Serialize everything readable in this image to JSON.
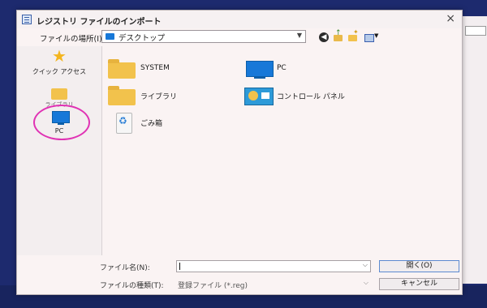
{
  "dialog": {
    "title": "レジストリ ファイルのインポート",
    "close_glyph": "×"
  },
  "location": {
    "label": "ファイルの場所(I):",
    "value": "デスクトップ"
  },
  "toolbar": {
    "back_glyph": "◀",
    "up_glyph": "↑",
    "new_folder_glyph": "✦",
    "view_menu_glyph": "▼"
  },
  "sidebar": {
    "items": [
      {
        "label": "クイック アクセス",
        "icon": "star-icon"
      },
      {
        "label": "ライブラリ",
        "icon": "folder-icon"
      },
      {
        "label": "PC",
        "icon": "monitor-icon"
      }
    ]
  },
  "files": [
    {
      "name": "SYSTEM",
      "icon": "folder-icon"
    },
    {
      "name": "PC",
      "icon": "monitor-icon"
    },
    {
      "name": "ライブラリ",
      "icon": "folder-icon"
    },
    {
      "name": "コントロール パネル",
      "icon": "control-panel-icon"
    },
    {
      "name": "ごみ箱",
      "icon": "recycle-bin-icon"
    }
  ],
  "bottom": {
    "filename_label": "ファイル名(N):",
    "filename_value": "",
    "filetype_label": "ファイルの種類(T):",
    "filetype_value": "登録ファイル (*.reg)",
    "open_button": "開く(O)",
    "cancel_button": "キャンセル"
  },
  "colors": {
    "desktop": "#1d2a6e",
    "folder": "#f2c24c",
    "monitor": "#1778d8",
    "highlight_circle": "#e032b4"
  }
}
